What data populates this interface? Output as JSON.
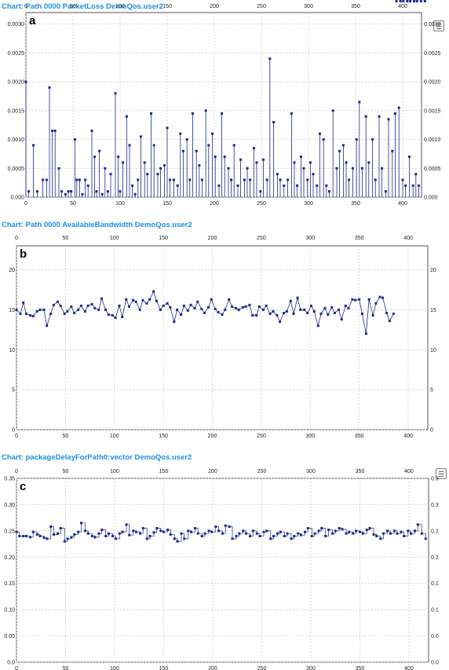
{
  "colors": {
    "title": "#1a8fe0",
    "series": "#1b2a8a",
    "grid": "#c8c8c8",
    "frame": "#555555"
  },
  "charts": [
    {
      "title": "Chart: Path 0000 PacketLoss DemoQos.user2",
      "panel_label": "a",
      "legend_icon": "list-icon"
    },
    {
      "title": "Chart: Path 0000 AvailableBandwidth DemoQos.user2",
      "panel_label": "b",
      "legend_icon": ""
    },
    {
      "title": "Chart: packageDelayForPath0:vector DemoQos.user2",
      "panel_label": "c",
      "legend_icon": "list-icon"
    }
  ],
  "chart_data": [
    {
      "type": "scatter",
      "style": "stem",
      "grid": true,
      "xlim": [
        0,
        420
      ],
      "ylim": [
        0,
        0.0032
      ],
      "x_ticks": [
        0,
        50,
        100,
        150,
        200,
        250,
        300,
        350,
        400
      ],
      "y_ticks": [
        0.0,
        0.0005,
        0.001,
        0.0015,
        0.002,
        0.0025,
        0.003
      ],
      "y_tick_labels": [
        "0.000",
        "0.0005",
        "0.0010",
        "0.0015",
        "0.0020",
        "0.0025",
        "0.0030"
      ],
      "x": [
        0,
        3,
        8,
        12,
        18,
        22,
        25,
        28,
        31,
        35,
        38,
        42,
        45,
        48,
        52,
        54,
        57,
        60,
        63,
        66,
        70,
        73,
        75,
        78,
        81,
        84,
        87,
        90,
        95,
        98,
        100,
        103,
        107,
        110,
        113,
        116,
        119,
        122,
        126,
        129,
        133,
        136,
        140,
        143,
        147,
        150,
        153,
        157,
        161,
        164,
        167,
        171,
        174,
        177,
        181,
        184,
        187,
        191,
        194,
        198,
        201,
        205,
        208,
        211,
        215,
        218,
        221,
        225,
        228,
        232,
        235,
        238,
        242,
        245,
        249,
        252,
        256,
        259,
        263,
        267,
        270,
        274,
        278,
        282,
        285,
        288,
        292,
        295,
        299,
        302,
        305,
        309,
        312,
        316,
        319,
        322,
        326,
        330,
        333,
        337,
        340,
        343,
        347,
        351,
        354,
        357,
        361,
        364,
        368,
        371,
        375,
        378,
        382,
        385,
        389,
        392,
        396,
        400,
        403,
        407,
        411,
        414,
        417
      ],
      "values": [
        0.002,
        0.0001,
        0.0009,
        0.0001,
        0.0003,
        0.0003,
        0.0019,
        0.00115,
        0.00115,
        0.0005,
        0.0001,
        5e-05,
        0.0001,
        0.0001,
        0.001,
        0.0003,
        0.0003,
        5e-05,
        0.0003,
        0.0002,
        0.00115,
        0.0007,
        0.0001,
        0.0008,
        5e-05,
        0.0005,
        0.0001,
        0.0004,
        0.0018,
        0.0007,
        0.0001,
        0.0006,
        0.0014,
        0.0009,
        0.0002,
        5e-05,
        0.0003,
        0.00105,
        0.0006,
        0.0004,
        0.00145,
        0.0009,
        0.0004,
        0.0005,
        0.00055,
        0.0012,
        0.0003,
        0.0003,
        0.0002,
        0.0011,
        0.0008,
        0.001,
        0.0003,
        0.00145,
        0.0008,
        0.00055,
        0.0003,
        0.0015,
        0.0009,
        0.0011,
        0.0007,
        0.0002,
        0.00145,
        0.0007,
        0.0005,
        0.0003,
        0.0009,
        0.0002,
        0.00065,
        0.0003,
        0.0005,
        0.0003,
        0.00085,
        0.0006,
        0.0001,
        0.00065,
        0.0003,
        0.0024,
        0.0013,
        0.0004,
        0.0003,
        0.0002,
        0.0003,
        0.00145,
        0.0006,
        0.0002,
        0.0007,
        0.0005,
        0.0003,
        0.0006,
        0.0004,
        0.0002,
        0.0011,
        0.001,
        0.0002,
        0.0001,
        0.0015,
        0.0005,
        0.0008,
        0.0009,
        0.0006,
        0.0003,
        0.0005,
        0.001,
        0.00165,
        0.0005,
        0.0014,
        0.0006,
        0.001,
        0.0003,
        0.0014,
        0.0005,
        0.0001,
        0.00135,
        0.0008,
        0.00145,
        0.00155,
        0.0003,
        0.0002,
        0.0007,
        0.0002,
        0.0004,
        0.0002
      ],
      "xlabel": "",
      "ylabel": ""
    },
    {
      "type": "line",
      "grid": true,
      "xlim": [
        0,
        420
      ],
      "ylim": [
        0,
        23
      ],
      "x_ticks": [
        0,
        50,
        100,
        150,
        200,
        250,
        300,
        350,
        400
      ],
      "y_ticks": [
        0,
        5,
        10,
        15,
        20
      ],
      "y_tick_labels": [
        "0",
        "5",
        "10",
        "15",
        "20"
      ],
      "x": [
        0,
        4,
        7,
        10,
        14,
        17,
        21,
        24,
        28,
        31,
        35,
        38,
        42,
        45,
        49,
        52,
        56,
        59,
        63,
        66,
        70,
        73,
        77,
        80,
        84,
        87,
        91,
        94,
        98,
        101,
        105,
        108,
        112,
        115,
        119,
        122,
        126,
        129,
        133,
        136,
        140,
        143,
        147,
        150,
        154,
        157,
        161,
        164,
        168,
        171,
        175,
        178,
        182,
        185,
        189,
        192,
        196,
        199,
        203,
        206,
        210,
        213,
        217,
        220,
        224,
        227,
        231,
        234,
        238,
        241,
        245,
        248,
        252,
        255,
        259,
        262,
        266,
        269,
        273,
        276,
        280,
        283,
        287,
        290,
        294,
        297,
        301,
        304,
        308,
        311,
        315,
        318,
        322,
        325,
        329,
        332,
        336,
        339,
        343,
        346,
        350,
        353,
        357,
        360,
        364,
        367,
        371,
        374,
        378,
        381,
        385,
        388,
        392,
        395,
        399,
        402,
        406,
        409,
        413,
        417
      ],
      "values": [
        15.0,
        14.5,
        15.9,
        14.5,
        14.3,
        14.2,
        14.8,
        15.0,
        15.0,
        13.0,
        14.5,
        15.6,
        16.0,
        15.5,
        14.5,
        14.8,
        15.4,
        14.6,
        15.0,
        15.5,
        14.8,
        15.5,
        15.7,
        15.2,
        15.0,
        16.4,
        15.0,
        14.4,
        14.3,
        14.0,
        15.5,
        14.1,
        16.3,
        15.4,
        16.2,
        16.0,
        15.0,
        16.2,
        15.8,
        16.3,
        17.3,
        16.1,
        15.0,
        15.5,
        15.8,
        15.3,
        13.5,
        15.0,
        14.4,
        15.5,
        14.9,
        15.6,
        15.2,
        16.0,
        15.1,
        14.6,
        15.3,
        16.3,
        15.1,
        14.7,
        14.4,
        15.0,
        16.3,
        15.4,
        15.2,
        15.0,
        15.3,
        15.4,
        15.6,
        14.3,
        14.3,
        15.4,
        15.0,
        15.5,
        14.5,
        14.8,
        14.3,
        13.5,
        14.6,
        14.8,
        16.1,
        14.5,
        16.5,
        15.0,
        15.0,
        14.6,
        15.5,
        14.8,
        13.0,
        14.5,
        15.2,
        14.4,
        15.3,
        14.6,
        15.0,
        13.8,
        15.5,
        15.2,
        16.3,
        16.2,
        16.3,
        14.5,
        12.0,
        16.3,
        14.3,
        15.8,
        16.6,
        16.5,
        14.6,
        13.6,
        14.5
      ]
    },
    {
      "type": "line",
      "style": "step",
      "grid": true,
      "xlim": [
        0,
        420
      ],
      "ylim": [
        0,
        0.35
      ],
      "x_ticks": [
        0,
        50,
        100,
        150,
        200,
        250,
        300,
        350,
        400
      ],
      "y_ticks": [
        0.0,
        0.05,
        0.1,
        0.15,
        0.2,
        0.25,
        0.3,
        0.35
      ],
      "y_tick_labels": [
        "0.0",
        "0.05",
        "0.10",
        "0.15",
        "0.20",
        "0.25",
        "0.30",
        "0.35"
      ],
      "right_tick_labels": [
        "0.0",
        "0.0",
        "0.1",
        "0.1",
        "0.2",
        "0.2",
        "0.3",
        "0.3"
      ],
      "x": [
        0,
        3,
        7,
        10,
        14,
        17,
        21,
        24,
        28,
        31,
        35,
        38,
        42,
        45,
        49,
        52,
        56,
        59,
        63,
        66,
        70,
        73,
        77,
        80,
        84,
        87,
        91,
        94,
        98,
        101,
        105,
        108,
        112,
        115,
        119,
        122,
        126,
        129,
        133,
        136,
        140,
        143,
        147,
        150,
        154,
        157,
        161,
        164,
        168,
        171,
        175,
        178,
        182,
        185,
        189,
        192,
        196,
        199,
        203,
        206,
        210,
        213,
        217,
        220,
        224,
        227,
        231,
        234,
        238,
        241,
        245,
        248,
        252,
        255,
        259,
        262,
        266,
        269,
        273,
        276,
        280,
        283,
        287,
        290,
        294,
        297,
        301,
        304,
        308,
        311,
        315,
        318,
        322,
        325,
        329,
        332,
        336,
        339,
        343,
        346,
        350,
        353,
        357,
        360,
        364,
        367,
        371,
        374,
        378,
        381,
        385,
        388,
        392,
        395,
        399,
        402,
        406,
        409,
        413,
        417
      ],
      "values": [
        0.248,
        0.24,
        0.24,
        0.24,
        0.238,
        0.248,
        0.243,
        0.24,
        0.237,
        0.235,
        0.258,
        0.243,
        0.245,
        0.255,
        0.23,
        0.235,
        0.238,
        0.243,
        0.248,
        0.265,
        0.25,
        0.245,
        0.24,
        0.238,
        0.245,
        0.252,
        0.24,
        0.245,
        0.24,
        0.235,
        0.245,
        0.248,
        0.262,
        0.242,
        0.25,
        0.248,
        0.245,
        0.255,
        0.235,
        0.24,
        0.247,
        0.255,
        0.25,
        0.248,
        0.252,
        0.243,
        0.235,
        0.23,
        0.245,
        0.235,
        0.25,
        0.248,
        0.255,
        0.245,
        0.24,
        0.245,
        0.25,
        0.248,
        0.258,
        0.25,
        0.245,
        0.26,
        0.258,
        0.235,
        0.24,
        0.245,
        0.25,
        0.245,
        0.24,
        0.25,
        0.245,
        0.24,
        0.248,
        0.25,
        0.235,
        0.24,
        0.245,
        0.248,
        0.24,
        0.245,
        0.235,
        0.24,
        0.245,
        0.242,
        0.248,
        0.255,
        0.24,
        0.245,
        0.25,
        0.255,
        0.24,
        0.252,
        0.245,
        0.25,
        0.255,
        0.253,
        0.245,
        0.248,
        0.245,
        0.25,
        0.248,
        0.245,
        0.252,
        0.255,
        0.243,
        0.24,
        0.235,
        0.245,
        0.25,
        0.245,
        0.25,
        0.245,
        0.248,
        0.24,
        0.25,
        0.245,
        0.25,
        0.262,
        0.245,
        0.235
      ],
      "xlabel": "",
      "ylabel": ""
    }
  ]
}
